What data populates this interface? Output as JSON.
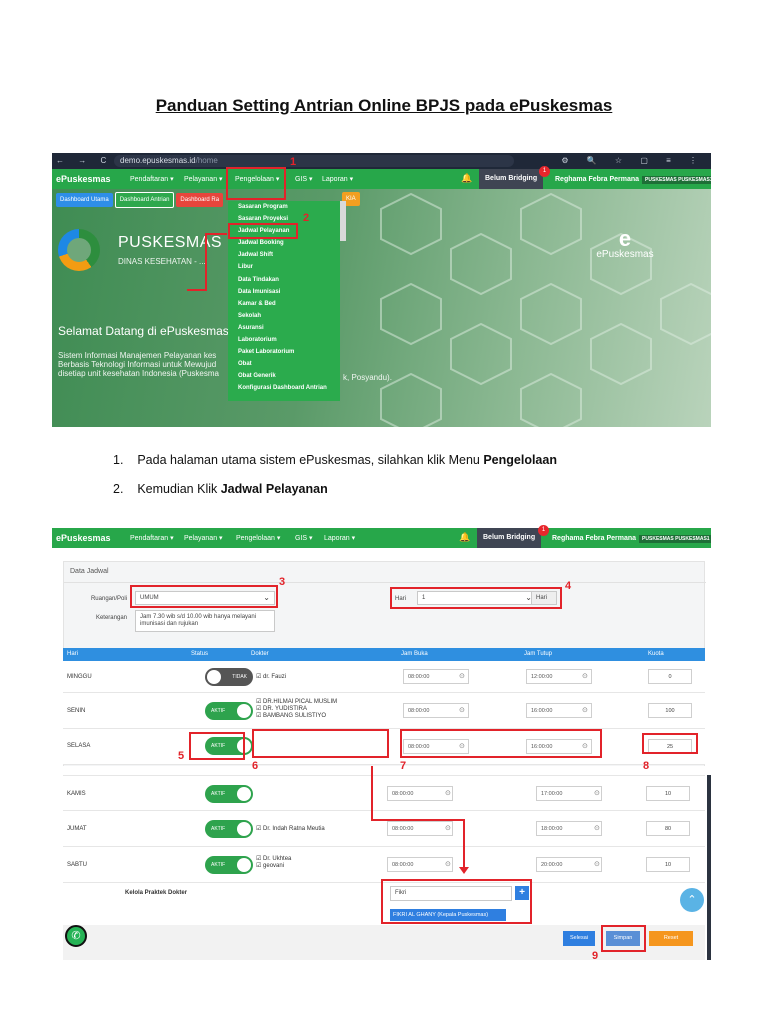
{
  "doc": {
    "title": "Panduan Setting Antrian Online BPJS pada ePuskesmas",
    "step1_prefix": "Pada halaman utama sistem ePuskesmas, silahkan klik Menu ",
    "step1_bold": "Pengelolaan",
    "step2_prefix": "Kemudian Klik ",
    "step2_bold": "Jadwal Pelayanan",
    "step1_num": "1.",
    "step2_num": "2."
  },
  "browser": {
    "url_host": "demo.epuskesmas.id",
    "url_path": "/home",
    "nav_icons": "← → C",
    "tool_icons": "⚙ 🔍 ☆ ▢ ≡ ⋮"
  },
  "appbar": {
    "logo": "ePuskesmas",
    "menu": [
      "Pendaftaran ▾",
      "Pelayanan ▾",
      "Pengelolaan ▾",
      "GIS ▾",
      "Laporan ▾"
    ],
    "bridging": "Belum Bridging",
    "badge": "1",
    "user": "Reghama Febra Permana",
    "user_tag": "PUSKESMAS PUSKESMAS1",
    "user_caret": "▾"
  },
  "dashboard": {
    "tabs": [
      "Dashboard Utama",
      "Dashboard Antrian",
      "Dashboard Ra",
      "KIA"
    ],
    "tab_colors": [
      "#2e8ee8",
      "#2ea84d",
      "#e8453c",
      "#f29f21"
    ],
    "hero_title": "PUSKESMAS PU",
    "hero_sub": "DINAS KESEHATAN - ...",
    "welcome": "Selamat Datang di ePuskesmas N",
    "desc": "Sistem Informasi Manajemen Pelayanan kes Berbasis Teknologi Informasi untuk Mewujud disetiap unit kesehatan Indonesia (Puskesma",
    "desc2": "k, Posyandu).",
    "brand": "ePuskesmas",
    "brand_mark": "e"
  },
  "dropdown": [
    "Sasaran Program",
    "Sasaran Proyeksi",
    "Jadwal Pelayanan",
    "Jadwal Booking",
    "Jadwal Shift",
    "Libur",
    "Data Tindakan",
    "Data Imunisasi",
    "Kamar & Bed",
    "Sekolah",
    "Asuransi",
    "Laboratorium",
    "Paket Laboratorium",
    "Obat",
    "Obat Generik",
    "Konfigurasi Dashboard Antrian"
  ],
  "markers": [
    "1",
    "2",
    "3",
    "4",
    "5",
    "6",
    "7",
    "8",
    "9"
  ],
  "form": {
    "header": "Data Jadwal",
    "ruangan_label": "Ruangan/Poli",
    "ruangan_value": "UMUM",
    "keterangan_label": "Keterangan",
    "keterangan_value": "Jam 7.30 wib s/d 10.00 wib hanya melayani imunisasi dan rujukan",
    "hari_label": "Hari",
    "hari_value": "1",
    "hari_suffix": "Hari"
  },
  "table": {
    "headers": [
      "Hari",
      "Status",
      "Dokter",
      "Jam Buka",
      "Jam Tutup",
      "Kuota"
    ],
    "rows": [
      {
        "day": "MINGGU",
        "status": "TIDAK",
        "on": false,
        "doctors": [
          "☑ dr. Fauzi"
        ],
        "open": "08:00:00",
        "close": "12:00:00",
        "kuota": "0"
      },
      {
        "day": "SENIN",
        "status": "AKTIF",
        "on": true,
        "doctors": [
          "☑ DR.HILMAI PICAL MUSLIM",
          "☑ DR. YUDISTIRA",
          "☑ BAMBANG SULISTIYO"
        ],
        "open": "08:00:00",
        "close": "16:00:00",
        "kuota": "100"
      },
      {
        "day": "SELASA",
        "status": "AKTIF",
        "on": true,
        "doctors": [],
        "open": "08:00:00",
        "close": "16:00:00",
        "kuota": "25"
      },
      {
        "day": "KAMIS",
        "status": "AKTIF",
        "on": true,
        "doctors": [],
        "open": "08:00:00",
        "close": "17:00:00",
        "kuota": "10"
      },
      {
        "day": "JUMAT",
        "status": "AKTIF",
        "on": true,
        "doctors": [
          "☑ Dr. Indah Ratna Meutia"
        ],
        "open": "08:00:00",
        "close": "18:00:00",
        "kuota": "80"
      },
      {
        "day": "SABTU",
        "status": "AKTIF",
        "on": true,
        "doctors": [
          "☑ Dr. Ukhtea",
          "☑ geovani"
        ],
        "open": "08:00:00",
        "close": "20:00:00",
        "kuota": "10"
      }
    ],
    "kelola_label": "Kelola Praktek Dokter",
    "kelola_input": "Fikri",
    "kelola_suggestion": "FIKRI AL GHANY (Kepala Puskesmas)",
    "plus": "+"
  },
  "buttons": {
    "selesai": "Selesai",
    "simpan": "Simpan",
    "reset": "Reset"
  },
  "icons": {
    "clock": "⊙",
    "whatsapp": "✆",
    "scroll_top": "⌃",
    "bell": "🔔",
    "select_caret": "⌄"
  }
}
